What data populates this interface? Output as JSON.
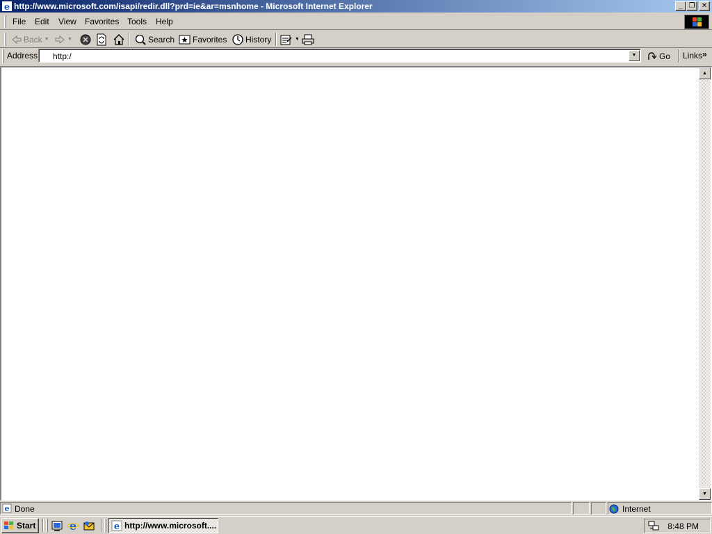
{
  "window": {
    "title": "http://www.microsoft.com/isapi/redir.dll?prd=ie&ar=msnhome - Microsoft Internet Explorer",
    "minimize": "_",
    "maximize": "❐",
    "close": "✕"
  },
  "menu": {
    "items": [
      "File",
      "Edit",
      "View",
      "Favorites",
      "Tools",
      "Help"
    ]
  },
  "toolbar": {
    "back_label": "Back",
    "search_label": "Search",
    "favorites_label": "Favorites",
    "history_label": "History"
  },
  "address": {
    "label": "Address",
    "value": "http:/",
    "go_label": "Go",
    "links_label": "Links",
    "links_more": "»"
  },
  "status": {
    "text": "Done",
    "zone": "Internet"
  },
  "taskbar": {
    "start_label": "Start",
    "task_label": "http://www.microsoft....",
    "clock": "8:48 PM"
  },
  "colors": {
    "titlebar_start": "#0a246a",
    "titlebar_end": "#a6caf0",
    "chrome": "#d4d0c8",
    "content": "#ffffff"
  }
}
